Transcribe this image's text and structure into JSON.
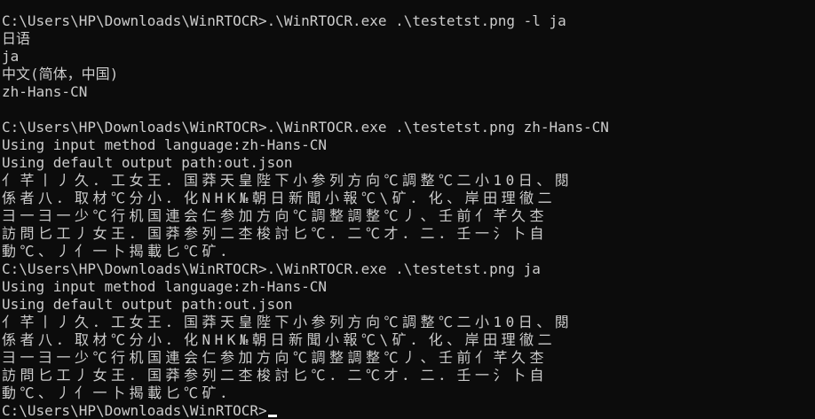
{
  "terminal": {
    "lines": [
      "C:\\Users\\HP\\Downloads\\WinRTOCR>.\\WinRTOCR.exe .\\testetst.png -l ja",
      "日语",
      "ja",
      "中文(简体，中国)",
      "zh-Hans-CN",
      "",
      "C:\\Users\\HP\\Downloads\\WinRTOCR>.\\WinRTOCR.exe .\\testetst.png zh-Hans-CN",
      "Using input method language:zh-Hans-CN",
      "Using default output path:out.json",
      "亻芊丨丿久．工女王．国莽天皇陛下小参列方向℃調整℃二小10日、閱",
      "係者八．取材℃分小．化NHK№朝日新聞小報℃\\矿．化、岸田理徹二",
      "彐一彐一少℃行机国連会仁参加方向℃調整調整℃丿、壬前亻芊久杢",
      "訪問匕工丿女王．国莽参列二杢梭討匕℃．二℃才．二．壬一氵卜自",
      "動℃、丿亻一卜揭載匕℃矿．",
      "C:\\Users\\HP\\Downloads\\WinRTOCR>.\\WinRTOCR.exe .\\testetst.png ja",
      "Using input method language:zh-Hans-CN",
      "Using default output path:out.json",
      "亻芊丨丿久．工女王．国莽天皇陛下小参列方向℃調整℃二小10日、閱",
      "係者八．取材℃分小．化NHK№朝日新聞小報℃\\矿．化、岸田理徹二",
      "彐一彐一少℃行机国連会仁参加方向℃調整調整℃丿、壬前亻芊久杢",
      "訪問匕工丿女王．国莽参列二杢梭討匕℃．二℃才．二．壬一氵卜自",
      "動℃、丿亻一卜揭載匕℃矿．"
    ],
    "prompt": "C:\\Users\\HP\\Downloads\\WinRTOCR>"
  },
  "colors": {
    "background": "#0c0c0c",
    "foreground": "#cccccc",
    "cursor": "#f2f2f2"
  }
}
